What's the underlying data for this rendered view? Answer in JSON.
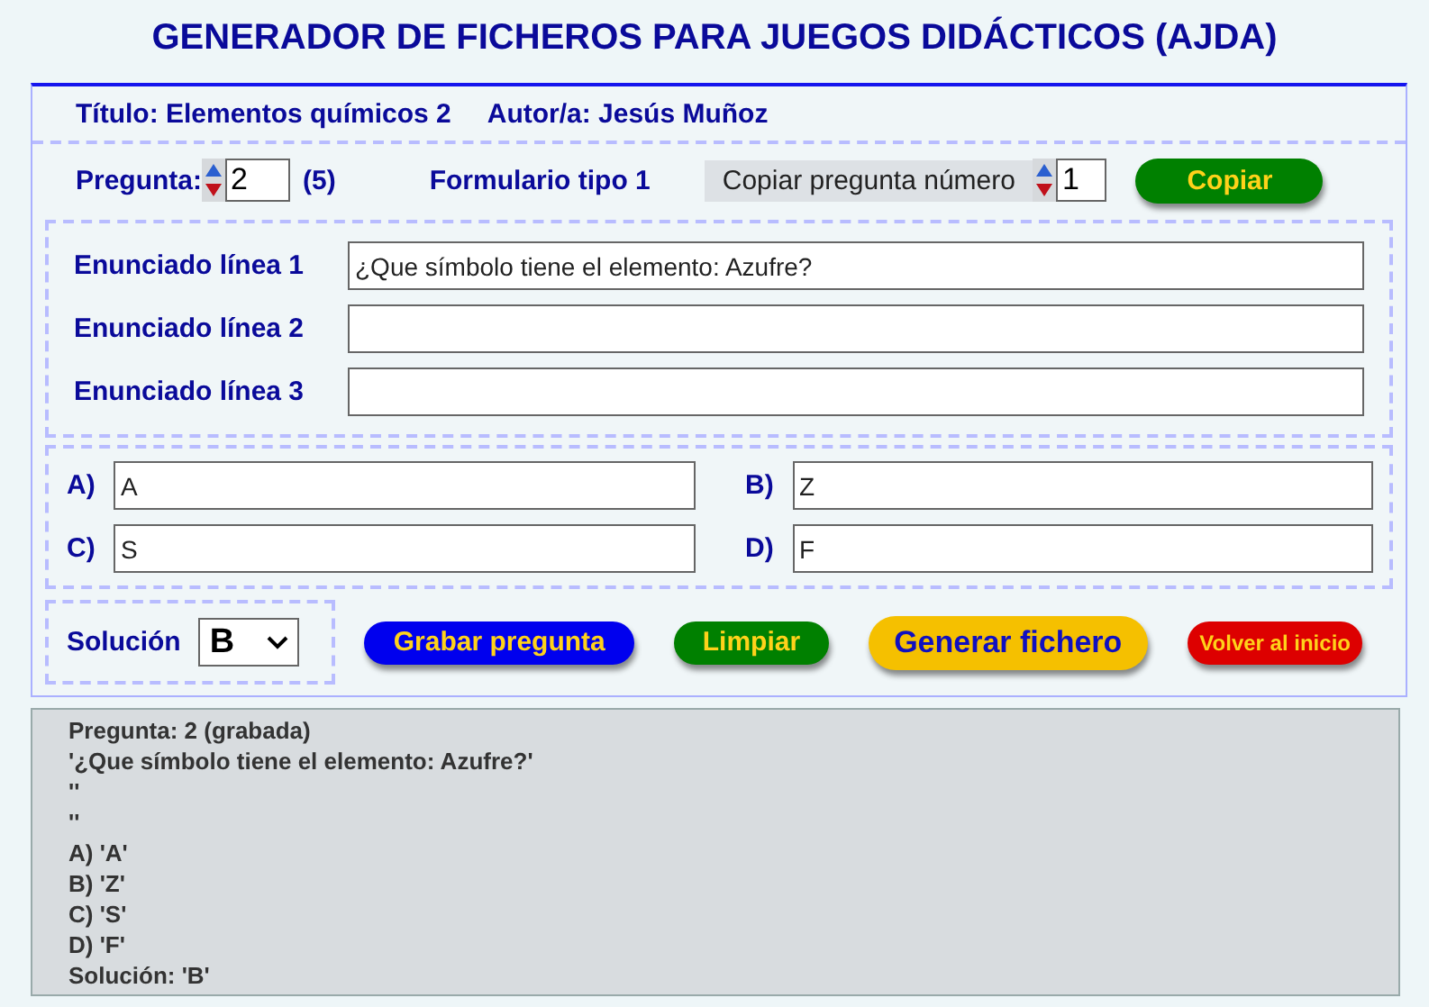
{
  "page_title": "GENERADOR DE FICHEROS PARA JUEGOS DIDÁCTICOS (AJDA)",
  "header": {
    "title": "Título: Elementos químicos 2",
    "author": "Autor/a: Jesús Muñoz"
  },
  "question": {
    "label": "Pregunta:",
    "value": "2",
    "total": "(5)",
    "form_type": "Formulario tipo 1",
    "copy_label": "Copiar pregunta número",
    "copy_value": "1",
    "copy_button": "Copiar"
  },
  "statement_lines": [
    {
      "label": "Enunciado línea 1",
      "value": "¿Que símbolo tiene el elemento: Azufre?"
    },
    {
      "label": "Enunciado línea 2"
    },
    {
      "label": "Enunciado línea 3"
    }
  ],
  "options": [
    {
      "label": "A)",
      "value": "A"
    },
    {
      "label": "B)",
      "value": "Z"
    },
    {
      "label": "C)",
      "value": "S"
    },
    {
      "label": "D)",
      "value": "F"
    }
  ],
  "solution": {
    "label": "Solución",
    "value": "B"
  },
  "buttons": [
    {
      "label": "Grabar pregunta",
      "kind": "normal",
      "color": "#0000ee"
    },
    {
      "label": "Limpiar",
      "kind": "normal",
      "color": "#008000"
    },
    {
      "label": "Generar fichero",
      "kind": "large",
      "color": "#f5c000"
    },
    {
      "label": "Volver al inicio",
      "kind": "small",
      "color": "#dd0000"
    }
  ],
  "summary": [
    "Pregunta: 2 (grabada)",
    "'¿Que símbolo tiene el elemento: Azufre?'",
    "''",
    "''",
    "A) 'A'",
    "B) 'Z'",
    "C) 'S'",
    "D) 'F'",
    "Solución: 'B'"
  ]
}
